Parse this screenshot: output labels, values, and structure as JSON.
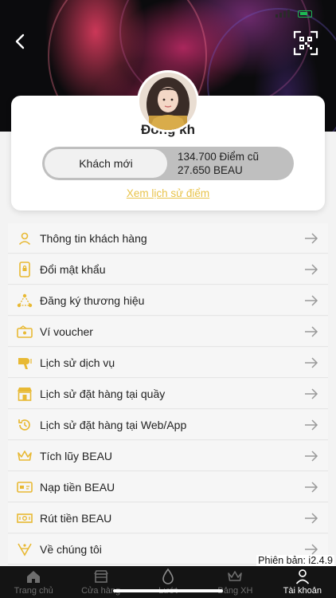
{
  "colors": {
    "accent": "#e8c34a",
    "icon_gold": "#e8b934",
    "tab_bg": "#141414"
  },
  "header": {
    "back_icon": "chevron-left-icon",
    "qr_icon": "qr-code-icon"
  },
  "profile": {
    "name": "Đồng kh",
    "tier": "Khách mới",
    "points_line1": "134.700 Điểm cũ",
    "points_line2": "27.650 BEAU",
    "history_link": "Xem lịch sử điểm"
  },
  "menu": [
    {
      "label": "Thông tin khách hàng",
      "icon": "user-icon"
    },
    {
      "label": "Đổi mật khẩu",
      "icon": "phone-lock-icon"
    },
    {
      "label": "Đăng ký thương hiệu",
      "icon": "network-icon"
    },
    {
      "label": "Ví voucher",
      "icon": "wallet-voucher-icon"
    },
    {
      "label": "Lịch sử dịch vụ",
      "icon": "hair-dryer-icon"
    },
    {
      "label": "Lịch sử đặt hàng tại quầy",
      "icon": "store-icon"
    },
    {
      "label": "Lịch sử đặt hàng tại Web/App",
      "icon": "history-icon"
    },
    {
      "label": "Tích lũy BEAU",
      "icon": "crown-icon"
    },
    {
      "label": "Nạp tiền BEAU",
      "icon": "card-deposit-icon"
    },
    {
      "label": "Rút tiền BEAU",
      "icon": "cash-withdraw-icon"
    },
    {
      "label": "Về chúng tôi",
      "icon": "about-icon"
    }
  ],
  "version": "Phiên bản: i2.4.9",
  "tabs": [
    {
      "label": "Trang chủ",
      "icon": "home-icon"
    },
    {
      "label": "Cửa hàng",
      "icon": "store-tab-icon"
    },
    {
      "label": "Lướt",
      "icon": "drop-icon"
    },
    {
      "label": "Bảng XH",
      "icon": "crown-tab-icon"
    },
    {
      "label": "Tài khoản",
      "icon": "account-icon"
    }
  ]
}
